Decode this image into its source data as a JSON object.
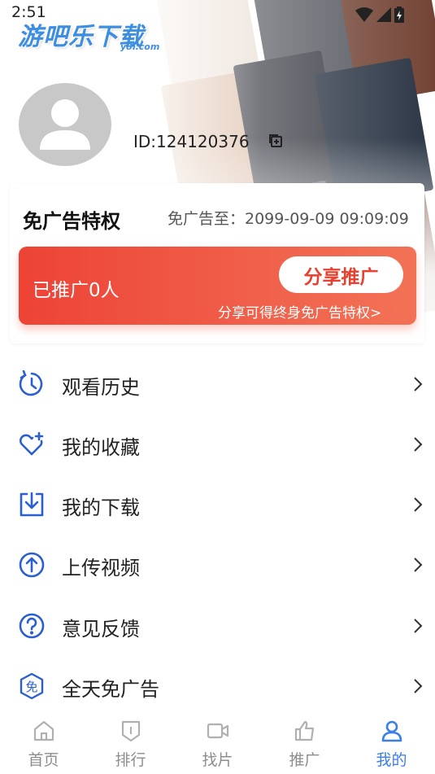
{
  "status_bar": {
    "time": "2:51"
  },
  "watermark": {
    "main": "游吧乐下载",
    "sub": "y8l.com"
  },
  "profile": {
    "user_id": "ID:124120376"
  },
  "vip": {
    "title": "免广告特权",
    "until": "免广告至：2099-09-09 09:09:09",
    "promoted_count": "已推广0人",
    "share_button": "分享推广",
    "share_tip": "分享可得终身免广告特权>"
  },
  "menu": [
    {
      "label": "观看历史",
      "icon": "history-icon"
    },
    {
      "label": "我的收藏",
      "icon": "favorite-heart-icon"
    },
    {
      "label": "我的下载",
      "icon": "download-icon"
    },
    {
      "label": "上传视频",
      "icon": "upload-icon"
    },
    {
      "label": "意见反馈",
      "icon": "feedback-question-icon"
    },
    {
      "label": "全天免广告",
      "icon": "ad-free-badge-icon"
    }
  ],
  "tabs": [
    {
      "label": "首页",
      "icon": "home-icon",
      "active": false
    },
    {
      "label": "排行",
      "icon": "ranking-icon",
      "active": false
    },
    {
      "label": "找片",
      "icon": "video-camera-icon",
      "active": false
    },
    {
      "label": "推广",
      "icon": "thumbs-up-icon",
      "active": false
    },
    {
      "label": "我的",
      "icon": "person-icon",
      "active": true
    }
  ],
  "colors": {
    "accent": "#3a7ee8",
    "promo_red": "#ed4336",
    "inactive_tab": "#8d8d8d"
  }
}
